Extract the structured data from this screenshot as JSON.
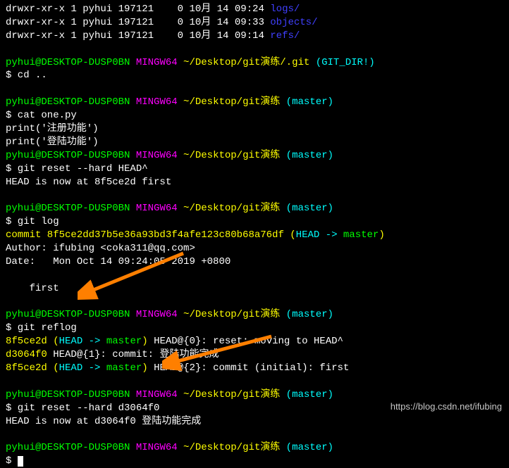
{
  "ls": {
    "l1": "drwxr-xr-x 1 pyhui 197121    0 10月 14 09:24 ",
    "l1dir": "logs/",
    "l2": "drwxr-xr-x 1 pyhui 197121    0 10月 14 09:33 ",
    "l2dir": "objects/",
    "l3": "drwxr-xr-x 1 pyhui 197121    0 10月 14 09:14 ",
    "l3dir": "refs/"
  },
  "prompt": {
    "user": "pyhui@DESKTOP-DUSP0BN",
    "sys": " MINGW64",
    "path1": " ~/Desktop/git演练/.git",
    "gitdir": " (GIT_DIR!)",
    "path2": " ~/Desktop/git演练",
    "branch": " (master)"
  },
  "cmd": {
    "cd": "$ cd ..",
    "cat": "$ cat one.py",
    "reset1": "$ git reset --hard HEAD^",
    "log": "$ git log",
    "reflog": "$ git reflog",
    "reset2": "$ git reset --hard d3064f0",
    "empty": "$ "
  },
  "out": {
    "print1": "print('注册功能')",
    "print2": "print('登陆功能')",
    "head1": "HEAD is now at 8f5ce2d first",
    "head2": "HEAD is now at d3064f0 登陆功能完成"
  },
  "log": {
    "commit": "commit 8f5ce2dd37b5e36a93bd3f4afe123c80b68a76df (",
    "headptr": "HEAD -> ",
    "master": "master",
    "close": ")",
    "author": "Author: ifubing <coka311@qq.com>",
    "date": "Date:   Mon Oct 14 09:24:05 2019 +0800",
    "msg": "    first"
  },
  "reflog": {
    "h1": "8f5ce2d",
    "r1open": " (",
    "r1head": "HEAD -> ",
    "r1master": "master",
    "r1close": ")",
    "r1rest": " HEAD@{0}: reset: moving to HEAD^",
    "h2": "d3064f0",
    "r2rest": " HEAD@{1}: commit: 登陆功能完成",
    "h3": "8f5ce2d",
    "r3open": " (",
    "r3head": "HEAD -> ",
    "r3master": "master",
    "r3close": ")",
    "r3rest": " HEAD@{2}: commit (initial): first"
  },
  "watermark": "https://blog.csdn.net/ifubing"
}
